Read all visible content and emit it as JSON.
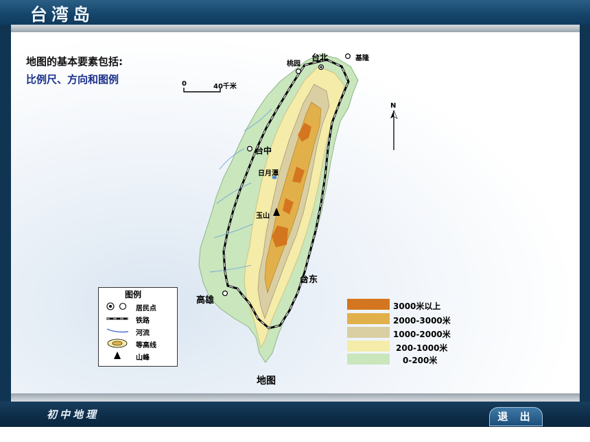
{
  "header": {
    "title": "台湾岛"
  },
  "intro": {
    "line1": "地图的基本要素包括:",
    "line2": "比例尺、方向和图例"
  },
  "scale": {
    "zero": "0",
    "value": "40千米"
  },
  "north": {
    "label": "N"
  },
  "places": {
    "taoyuan": "桃园",
    "taipei": "台北",
    "keelung": "基隆",
    "taichung": "台中",
    "sunmoonlake": "日月潭",
    "yushan": "玉山",
    "taitung": "台东",
    "kaohsiung": "高雄"
  },
  "legend": {
    "title": "图例",
    "items": [
      {
        "icon": "settlement-icon",
        "label": "居民点"
      },
      {
        "icon": "railway-icon",
        "label": "铁路"
      },
      {
        "icon": "river-icon",
        "label": "河流"
      },
      {
        "icon": "contour-icon",
        "label": "等高线"
      },
      {
        "icon": "peak-icon",
        "label": "山峰"
      }
    ]
  },
  "elevation_legend": [
    {
      "label": "3000米以上",
      "color": "#d4761f"
    },
    {
      "label": "2000-3000米",
      "color": "#e2b04a"
    },
    {
      "label": "1000-2000米",
      "color": "#d9cfa3"
    },
    {
      "label": "200-1000米",
      "color": "#f4eca8"
    },
    {
      "label": "0-200米",
      "color": "#c9e6bd"
    }
  ],
  "map_caption": "地图",
  "footer": {
    "course": "初中地理",
    "exit_label": "退 出"
  },
  "colors": {
    "header": "#16466b",
    "highlight_text": "#1a2f8a"
  }
}
